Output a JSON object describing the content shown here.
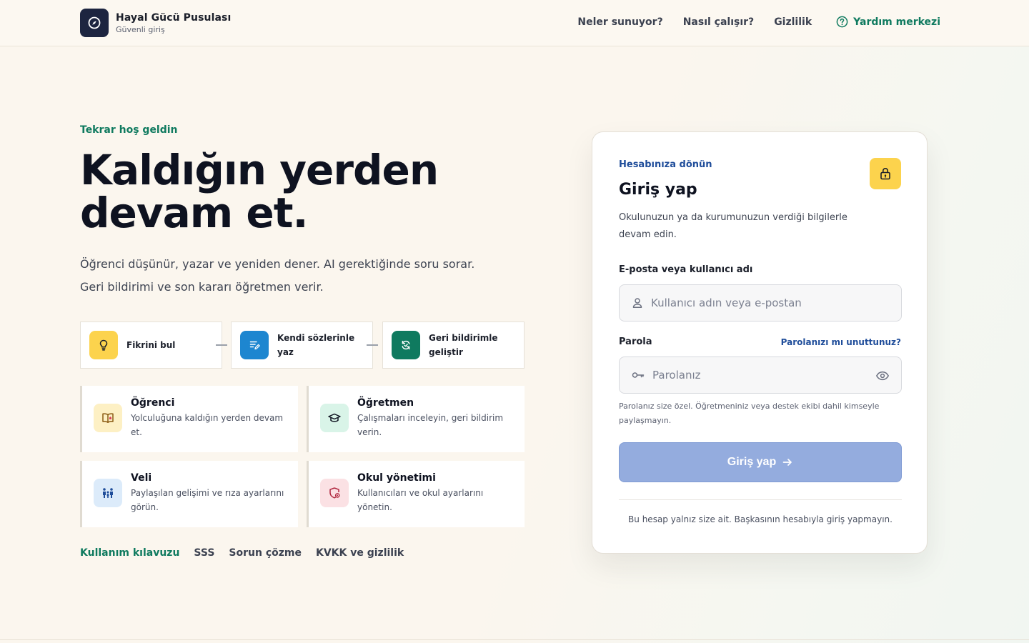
{
  "brand": {
    "name": "Hayal Gücü Pusulası",
    "subtitle": "Güvenli giriş"
  },
  "nav": {
    "items": [
      "Neler sunuyor?",
      "Nasıl çalışır?",
      "Gizlilik"
    ],
    "help": "Yardım merkezi"
  },
  "hero": {
    "eyebrow": "Tekrar hoş geldin",
    "headline_line1": "Kaldığın yerden",
    "headline_line2": "devam et.",
    "lead": "Öğrenci düşünür, yazar ve yeniden dener. AI gerektiğinde soru sorar. Geri bildirimi ve son kararı öğretmen verir."
  },
  "steps": [
    {
      "label": "Fikrini bul",
      "icon": "lightbulb-icon",
      "color": "#fcd34d"
    },
    {
      "label": "Kendi sözlerinle yaz",
      "icon": "write-icon",
      "color": "#1d86d0"
    },
    {
      "label": "Geri bildirimle geliştir",
      "icon": "refresh-icon",
      "color": "#0f7a5f"
    }
  ],
  "roles": [
    {
      "title": "Öğrenci",
      "desc": "Yolculuğuna kaldığın yerden devam et.",
      "icon": "book-icon",
      "color": "#fdf0c4"
    },
    {
      "title": "Öğretmen",
      "desc": "Çalışmaları inceleyin, geri bildirim verin.",
      "icon": "graduation-cap-icon",
      "color": "#d9f4e8"
    },
    {
      "title": "Veli",
      "desc": "Paylaşılan gelişimi ve rıza ayarlarını görün.",
      "icon": "family-icon",
      "color": "#dcebfa"
    },
    {
      "title": "Okul yönetimi",
      "desc": "Kullanıcıları ve okul ayarlarını yönetin.",
      "icon": "shield-icon",
      "color": "#fbe1e4"
    }
  ],
  "footer_links": [
    "Kullanım kılavuzu",
    "SSS",
    "Sorun çözme",
    "KVKK ve gizlilik"
  ],
  "login": {
    "eyebrow": "Hesabınıza dönün",
    "title": "Giriş yap",
    "description": "Okulunuzun ya da kurumunuzun verdiği bilgilerle devam edin.",
    "username_label": "E-posta veya kullanıcı adı",
    "username_placeholder": "Kullanıcı adın veya e-postan",
    "username_value": "",
    "password_label": "Parola",
    "forgot": "Parolanızı mı unuttunuz?",
    "password_placeholder": "Parolanız",
    "password_value": "",
    "hint": "Parolanız size özel. Öğretmeniniz veya destek ekibi dahil kimseyle paylaşmayın.",
    "submit": "Giriş yap",
    "note": "Bu hesap yalnız size ait. Başkasının hesabıyla giriş yapmayın."
  },
  "colors": {
    "accent_green": "#0f7a5f",
    "accent_blue": "#1f4d9a",
    "button_disabled": "#94acde",
    "brand_dark": "#1d2540"
  }
}
